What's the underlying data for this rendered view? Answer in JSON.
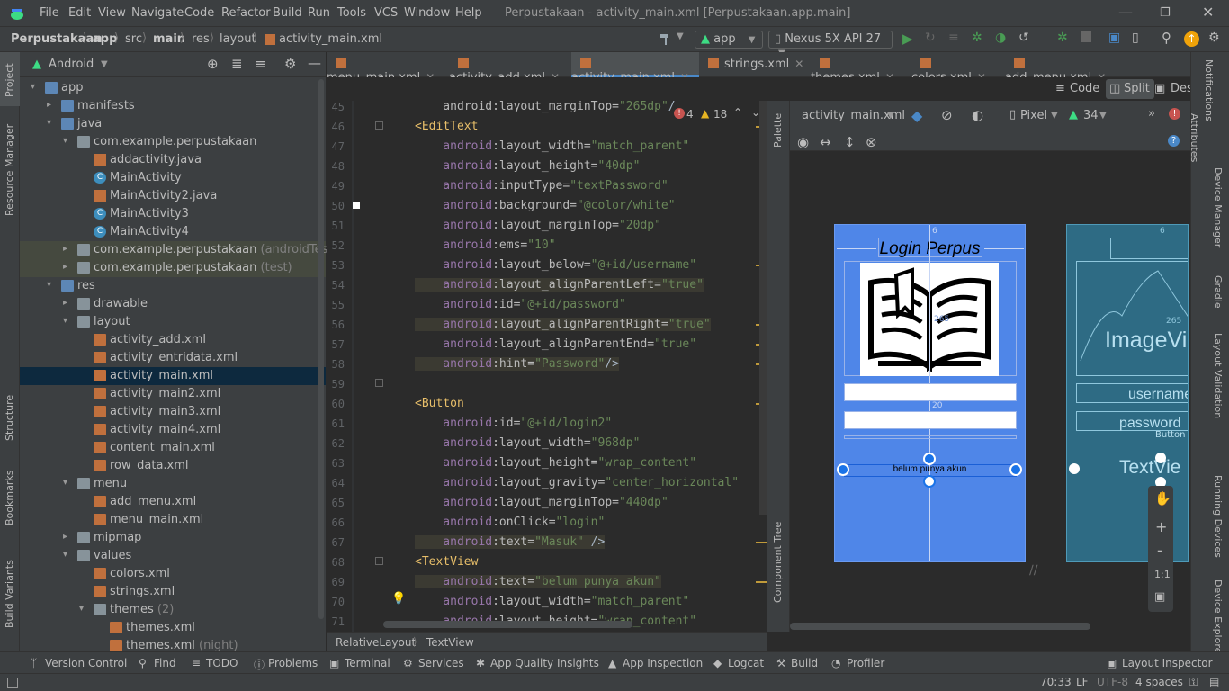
{
  "menu": {
    "items": [
      "File",
      "Edit",
      "View",
      "Navigate",
      "Code",
      "Refactor",
      "Build",
      "Run",
      "Tools",
      "VCS",
      "Window",
      "Help"
    ],
    "window_title": "Perpustakaan - activity_main.xml [Perpustakaan.app.main]"
  },
  "breadcrumb": [
    "Perpustakaan",
    "app",
    "src",
    "main",
    "res",
    "layout",
    "activity_main.xml"
  ],
  "toolbar": {
    "run_config": "app",
    "device": "Nexus 5X API 27"
  },
  "left_stripe": [
    "Project",
    "Resource Manager",
    "Structure",
    "Bookmarks",
    "Build Variants"
  ],
  "project": {
    "view_mode": "Android",
    "tree": [
      {
        "label": "app",
        "indent": 0,
        "arrow": "open",
        "icon": "folder-blue"
      },
      {
        "label": "manifests",
        "indent": 1,
        "arrow": "closed",
        "icon": "folder-blue"
      },
      {
        "label": "java",
        "indent": 1,
        "arrow": "open",
        "icon": "folder-blue"
      },
      {
        "label": "com.example.perpustakaan",
        "indent": 2,
        "arrow": "open",
        "icon": "folder"
      },
      {
        "label": "addactivity.java",
        "indent": 3,
        "arrow": "",
        "icon": "java"
      },
      {
        "label": "MainActivity",
        "indent": 3,
        "arrow": "",
        "icon": "class"
      },
      {
        "label": "MainActivity2.java",
        "indent": 3,
        "arrow": "",
        "icon": "java"
      },
      {
        "label": "MainActivity3",
        "indent": 3,
        "arrow": "",
        "icon": "class"
      },
      {
        "label": "MainActivity4",
        "indent": 3,
        "arrow": "",
        "icon": "class"
      },
      {
        "label": "com.example.perpustakaan",
        "sub": "(androidTest)",
        "indent": 2,
        "arrow": "closed",
        "icon": "folder",
        "band": true
      },
      {
        "label": "com.example.perpustakaan",
        "sub": "(test)",
        "indent": 2,
        "arrow": "closed",
        "icon": "folder",
        "band": true
      },
      {
        "label": "res",
        "indent": 1,
        "arrow": "open",
        "icon": "folder-blue"
      },
      {
        "label": "drawable",
        "indent": 2,
        "arrow": "closed",
        "icon": "folder"
      },
      {
        "label": "layout",
        "indent": 2,
        "arrow": "open",
        "icon": "folder"
      },
      {
        "label": "activity_add.xml",
        "indent": 3,
        "arrow": "",
        "icon": "xml"
      },
      {
        "label": "activity_entridata.xml",
        "indent": 3,
        "arrow": "",
        "icon": "xml"
      },
      {
        "label": "activity_main.xml",
        "indent": 3,
        "arrow": "",
        "icon": "xml",
        "selected": true
      },
      {
        "label": "activity_main2.xml",
        "indent": 3,
        "arrow": "",
        "icon": "xml"
      },
      {
        "label": "activity_main3.xml",
        "indent": 3,
        "arrow": "",
        "icon": "xml"
      },
      {
        "label": "activity_main4.xml",
        "indent": 3,
        "arrow": "",
        "icon": "xml"
      },
      {
        "label": "content_main.xml",
        "indent": 3,
        "arrow": "",
        "icon": "xml"
      },
      {
        "label": "row_data.xml",
        "indent": 3,
        "arrow": "",
        "icon": "xml"
      },
      {
        "label": "menu",
        "indent": 2,
        "arrow": "open",
        "icon": "folder"
      },
      {
        "label": "add_menu.xml",
        "indent": 3,
        "arrow": "",
        "icon": "xml"
      },
      {
        "label": "menu_main.xml",
        "indent": 3,
        "arrow": "",
        "icon": "xml"
      },
      {
        "label": "mipmap",
        "indent": 2,
        "arrow": "closed",
        "icon": "folder"
      },
      {
        "label": "values",
        "indent": 2,
        "arrow": "open",
        "icon": "folder"
      },
      {
        "label": "colors.xml",
        "indent": 3,
        "arrow": "",
        "icon": "xml"
      },
      {
        "label": "strings.xml",
        "indent": 3,
        "arrow": "",
        "icon": "xml"
      },
      {
        "label": "themes",
        "sub": "(2)",
        "indent": 3,
        "arrow": "open",
        "icon": "folder"
      },
      {
        "label": "themes.xml",
        "indent": 4,
        "arrow": "",
        "icon": "xml"
      },
      {
        "label": "themes.xml",
        "sub": "(night)",
        "indent": 4,
        "arrow": "",
        "icon": "xml"
      }
    ]
  },
  "editor_tabs": [
    "menu_main.xml",
    "activity_add.xml",
    "activity_main.xml",
    "strings.xml",
    "themes.xml",
    "colors.xml",
    "add_menu.xml"
  ],
  "active_tab": "activity_main.xml",
  "view_modes": {
    "code": "Code",
    "split": "Split",
    "design": "Design"
  },
  "inspections": {
    "errors": "4",
    "warnings": "18"
  },
  "code": {
    "lines": [
      {
        "n": "45",
        "parts": [
          [
            "attr",
            "    android:layout_marginTop="
          ],
          [
            "val",
            "\"265dp\""
          ],
          [
            "punct",
            "/"
          ]
        ]
      },
      {
        "n": "46",
        "parts": [
          [
            "tag",
            "<EditText"
          ]
        ]
      },
      {
        "n": "47",
        "parts": [
          [
            "ns",
            "    android"
          ],
          [
            "attr",
            ":layout_width="
          ],
          [
            "val",
            "\"match_parent\""
          ]
        ]
      },
      {
        "n": "48",
        "parts": [
          [
            "ns",
            "    android"
          ],
          [
            "attr",
            ":layout_height="
          ],
          [
            "val",
            "\"40dp\""
          ]
        ]
      },
      {
        "n": "49",
        "parts": [
          [
            "ns",
            "    android"
          ],
          [
            "attr",
            ":inputType="
          ],
          [
            "val",
            "\"textPassword\""
          ]
        ]
      },
      {
        "n": "50",
        "parts": [
          [
            "ns",
            "    android"
          ],
          [
            "attr",
            ":background="
          ],
          [
            "val",
            "\"@color/white\""
          ]
        ]
      },
      {
        "n": "51",
        "parts": [
          [
            "ns",
            "    android"
          ],
          [
            "attr",
            ":layout_marginTop="
          ],
          [
            "val",
            "\"20dp\""
          ]
        ]
      },
      {
        "n": "52",
        "parts": [
          [
            "ns",
            "    android"
          ],
          [
            "attr",
            ":ems="
          ],
          [
            "val",
            "\"10\""
          ]
        ]
      },
      {
        "n": "53",
        "parts": [
          [
            "ns",
            "    android"
          ],
          [
            "attr",
            ":layout_below="
          ],
          [
            "val",
            "\"@+id/username\""
          ]
        ]
      },
      {
        "n": "54",
        "parts": [
          [
            "ns",
            "    android"
          ],
          [
            "attr",
            ":layout_alignParentLeft="
          ],
          [
            "val",
            "\"true\""
          ]
        ],
        "hl": true
      },
      {
        "n": "55",
        "parts": [
          [
            "ns",
            "    android"
          ],
          [
            "attr",
            ":id="
          ],
          [
            "val",
            "\"@+id/password\""
          ]
        ]
      },
      {
        "n": "56",
        "parts": [
          [
            "ns",
            "    android"
          ],
          [
            "attr",
            ":layout_alignParentRight="
          ],
          [
            "val",
            "\"true\""
          ]
        ],
        "hl": true
      },
      {
        "n": "57",
        "parts": [
          [
            "ns",
            "    android"
          ],
          [
            "attr",
            ":layout_alignParentEnd="
          ],
          [
            "val",
            "\"true\""
          ]
        ]
      },
      {
        "n": "58",
        "parts": [
          [
            "ns",
            "    android"
          ],
          [
            "attr",
            ":hint="
          ],
          [
            "val",
            "\"Password\""
          ],
          [
            "punct",
            "/>"
          ]
        ],
        "hl": true
      },
      {
        "n": "59",
        "parts": []
      },
      {
        "n": "60",
        "parts": [
          [
            "tag",
            "<Button"
          ]
        ]
      },
      {
        "n": "61",
        "parts": [
          [
            "ns",
            "    android"
          ],
          [
            "attr",
            ":id="
          ],
          [
            "val",
            "\"@+id/login2\""
          ]
        ]
      },
      {
        "n": "62",
        "parts": [
          [
            "ns",
            "    android"
          ],
          [
            "attr",
            ":layout_width="
          ],
          [
            "val",
            "\"968dp\""
          ]
        ]
      },
      {
        "n": "63",
        "parts": [
          [
            "ns",
            "    android"
          ],
          [
            "attr",
            ":layout_height="
          ],
          [
            "val",
            "\"wrap_content\""
          ]
        ]
      },
      {
        "n": "64",
        "parts": [
          [
            "ns",
            "    android"
          ],
          [
            "attr",
            ":layout_gravity="
          ],
          [
            "val",
            "\"center_horizontal\""
          ]
        ]
      },
      {
        "n": "65",
        "parts": [
          [
            "ns",
            "    android"
          ],
          [
            "attr",
            ":layout_marginTop="
          ],
          [
            "val",
            "\"440dp\""
          ]
        ]
      },
      {
        "n": "66",
        "parts": [
          [
            "ns",
            "    android"
          ],
          [
            "attr",
            ":onClick="
          ],
          [
            "val",
            "\"login\""
          ]
        ]
      },
      {
        "n": "67",
        "parts": [
          [
            "ns",
            "    android"
          ],
          [
            "attr",
            ":text="
          ],
          [
            "val",
            "\"Masuk\""
          ],
          [
            "punct",
            " />"
          ]
        ],
        "hl": true
      },
      {
        "n": "68",
        "parts": [
          [
            "tag",
            "<TextView"
          ]
        ]
      },
      {
        "n": "69",
        "parts": [
          [
            "ns",
            "    android"
          ],
          [
            "attr",
            ":text="
          ],
          [
            "val",
            "\"belum punya akun\""
          ]
        ],
        "hl": true
      },
      {
        "n": "70",
        "parts": [
          [
            "ns",
            "    android"
          ],
          [
            "attr",
            ":layout_width="
          ],
          [
            "val",
            "\"match_parent\""
          ]
        ]
      },
      {
        "n": "71",
        "parts": [
          [
            "ns",
            "    android"
          ],
          [
            "attr",
            ":layout_height="
          ],
          [
            "val",
            "\"wrap_content\""
          ]
        ]
      }
    ]
  },
  "design_toolbar": {
    "file": "activity_main.xml",
    "pixel": "Pixel",
    "api": "34"
  },
  "palette_labels": [
    "Palette",
    "Component Tree"
  ],
  "preview": {
    "title": "Login Perpus",
    "bottom_text": "belum punya akun",
    "margin_label_1": "6",
    "margin_label_2": "20",
    "margin_label_3": "265",
    "blueprint_image": "ImageVi",
    "blueprint_username": "username",
    "blueprint_password": "password",
    "blueprint_button": "Button",
    "blueprint_textview": "TextVie"
  },
  "zoom_controls": [
    "+",
    "-",
    "1:1"
  ],
  "right_stripe": [
    "Notifications",
    "Attributes",
    "Device Manager",
    "Gradle",
    "Layout Validation",
    "Running Devices",
    "Device Explorer"
  ],
  "breadcrumb2": [
    "RelativeLayout",
    "TextView"
  ],
  "bottom_tabs": [
    "Version Control",
    "Find",
    "TODO",
    "Problems",
    "Terminal",
    "Services",
    "App Quality Insights",
    "App Inspection",
    "Logcat",
    "Build",
    "Profiler",
    "Layout Inspector"
  ],
  "status": {
    "position": "70:33",
    "line_sep": "LF",
    "encoding": "UTF-8",
    "indent": "4 spaces"
  }
}
